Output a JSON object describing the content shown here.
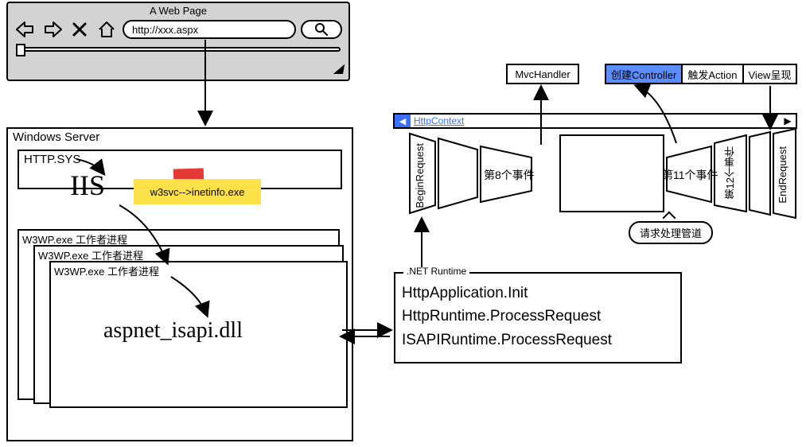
{
  "browser": {
    "title": "A Web Page",
    "url": "http://xxx.aspx"
  },
  "windows_server": {
    "title": "Windows Server",
    "http_sys": "HTTP.SYS",
    "iis": "IIS",
    "sticky_note": "w3svc-->inetinfo.exe",
    "worker_processes": [
      "W3WP.exe 工作者进程",
      "W3WP.exe 工作者进程",
      "W3WP.exe 工作者进程"
    ],
    "isapi_dll": "aspnet_isapi.dll"
  },
  "net_runtime": {
    "title": ".NET Runtime",
    "lines": [
      "HttpApplication.Init",
      "HttpRuntime.ProcessRequest",
      "ISAPIRuntime.ProcessRequest"
    ]
  },
  "context_bar": "HttpContext",
  "pipeline": {
    "mvc_handler": "MvcHandler",
    "create_controller": "创建Controller",
    "trigger_action": "触发Action",
    "view_render": "View呈现",
    "begin_request": "BeginRequest",
    "event8": "第8个事件",
    "event11": "第11个事件",
    "event12": "第12个事件",
    "end_request": "EndRequest",
    "bubble": "请求处理管道"
  }
}
